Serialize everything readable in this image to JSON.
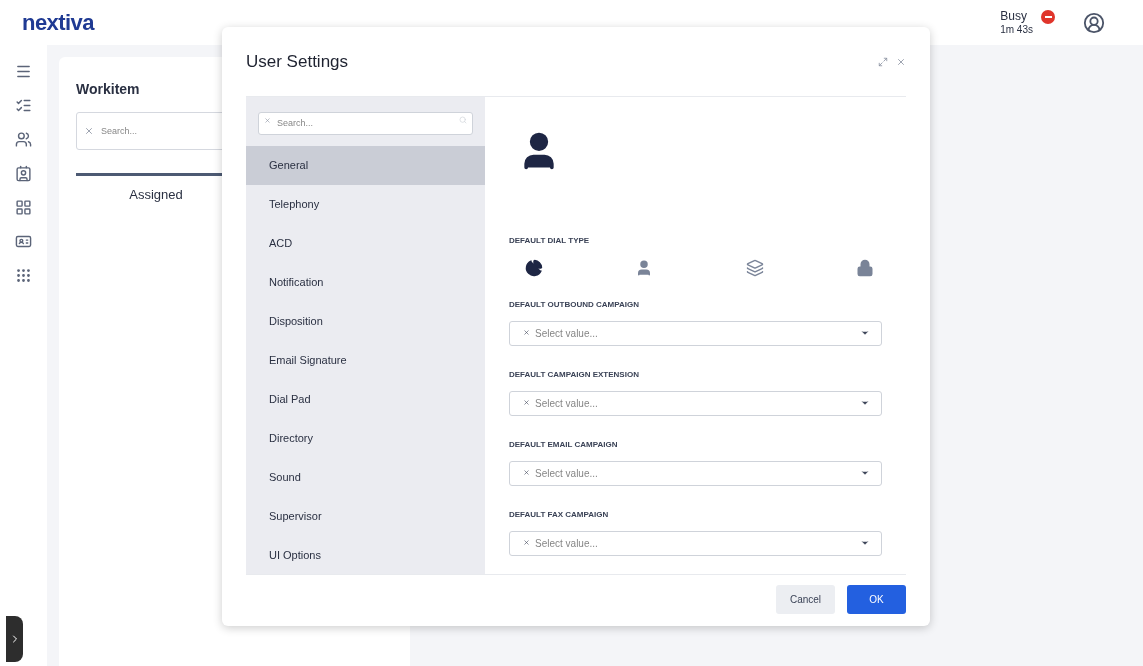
{
  "header": {
    "logo": "nextiva",
    "status": {
      "label": "Busy",
      "timer": "1m 43s",
      "color": "#e0352b"
    }
  },
  "sidebar": {
    "items": [
      {
        "kind": "menu"
      },
      {
        "kind": "list"
      },
      {
        "kind": "people"
      },
      {
        "kind": "contact"
      },
      {
        "kind": "apps"
      },
      {
        "kind": "card"
      },
      {
        "kind": "dialpad"
      }
    ]
  },
  "workitem": {
    "title": "Workitem",
    "search": {
      "placeholder": "Search..."
    },
    "tabs": [
      {
        "label": "Assigned",
        "selected": true
      }
    ]
  },
  "dialog": {
    "title": "User Settings",
    "search": {
      "placeholder": "Search..."
    },
    "nav": [
      {
        "label": "General",
        "selected": true
      },
      {
        "label": "Telephony",
        "selected": false
      },
      {
        "label": "ACD",
        "selected": false
      },
      {
        "label": "Notification",
        "selected": false
      },
      {
        "label": "Disposition",
        "selected": false
      },
      {
        "label": "Email Signature",
        "selected": false
      },
      {
        "label": "Dial Pad",
        "selected": false
      },
      {
        "label": "Directory",
        "selected": false
      },
      {
        "label": "Sound",
        "selected": false
      },
      {
        "label": "Supervisor",
        "selected": false
      },
      {
        "label": "UI Options",
        "selected": false
      }
    ],
    "dial_type": {
      "label": "DEFAULT DIAL TYPE",
      "options": [
        {
          "kind": "pie",
          "selected": true
        },
        {
          "kind": "person",
          "selected": false
        },
        {
          "kind": "layers",
          "selected": false
        },
        {
          "kind": "lock",
          "selected": false
        }
      ]
    },
    "fields": [
      {
        "label": "DEFAULT OUTBOUND CAMPAIGN",
        "placeholder": "Select value..."
      },
      {
        "label": "DEFAULT CAMPAIGN EXTENSION",
        "placeholder": "Select value..."
      },
      {
        "label": "DEFAULT EMAIL CAMPAIGN",
        "placeholder": "Select value..."
      },
      {
        "label": "DEFAULT FAX CAMPAIGN",
        "placeholder": "Select value..."
      }
    ],
    "buttons": [
      {
        "label": "Cancel",
        "kind": "secondary"
      },
      {
        "label": "OK",
        "kind": "primary"
      }
    ]
  }
}
